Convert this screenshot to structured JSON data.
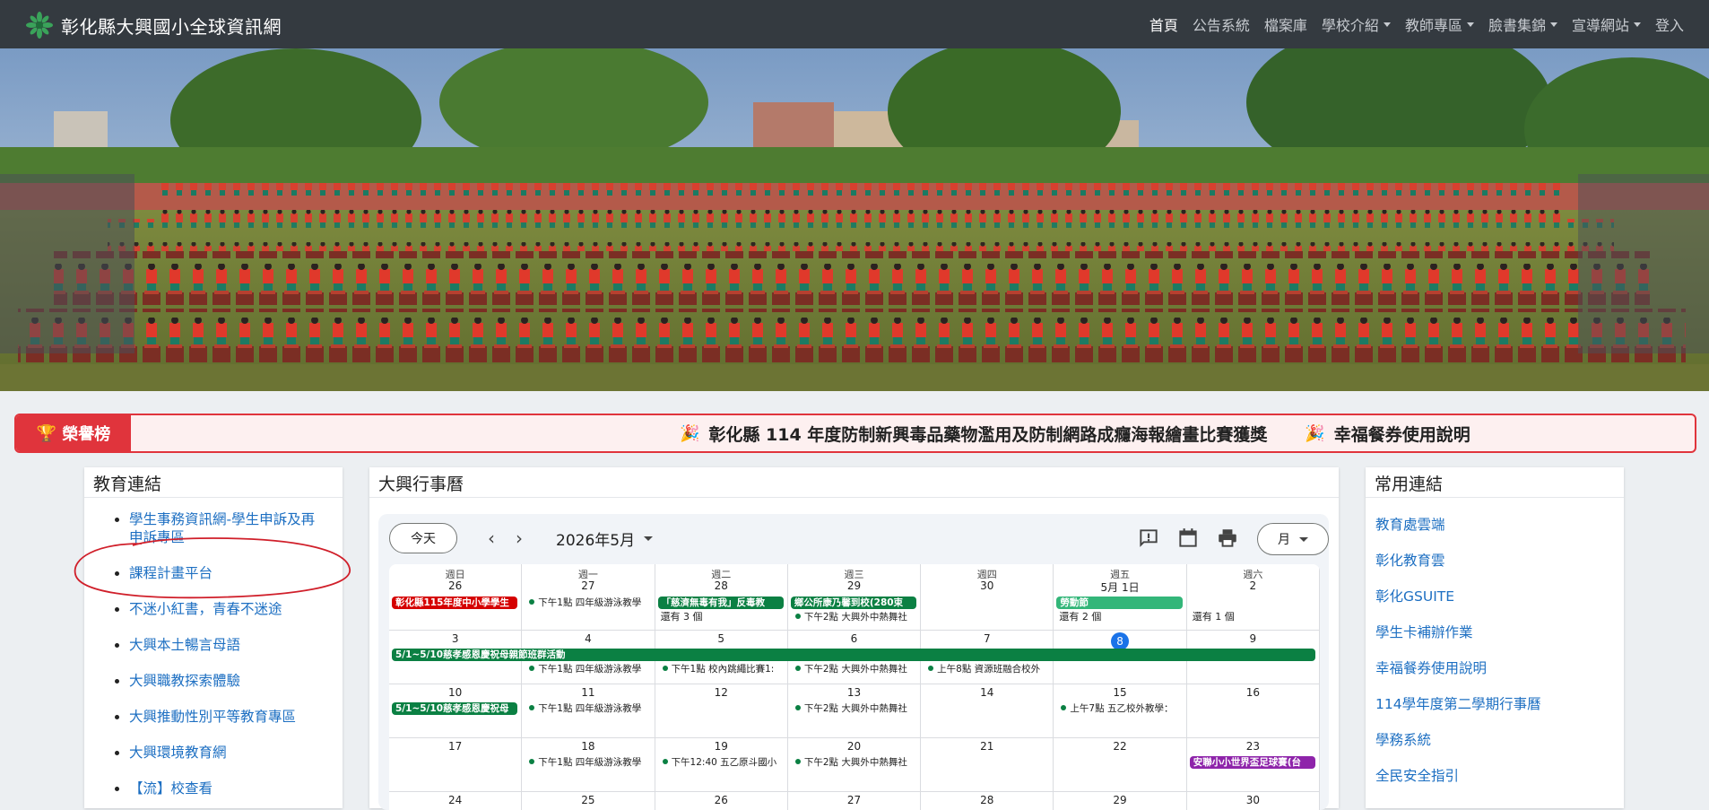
{
  "navbar": {
    "brand": "彰化縣大興國小全球資訊網",
    "items": [
      {
        "label": "首頁",
        "active": true,
        "dropdown": false
      },
      {
        "label": "公告系統",
        "dropdown": false
      },
      {
        "label": "檔案庫",
        "dropdown": false
      },
      {
        "label": "學校介紹",
        "dropdown": true
      },
      {
        "label": "教師專區",
        "dropdown": true
      },
      {
        "label": "臉書集錦",
        "dropdown": true
      },
      {
        "label": "宣導網站",
        "dropdown": true
      },
      {
        "label": "登入",
        "dropdown": false
      }
    ]
  },
  "honor": {
    "label": "榮譽榜",
    "icon": "trophy-icon",
    "items": [
      "彰化縣 114 年度防制新興毒品藥物濫用及防制網路成癮海報繪畫比賽獲獎",
      "幸福餐券使用說明"
    ]
  },
  "edu_links": {
    "title": "教育連結",
    "items": [
      "學生事務資訊網-學生申訴及再申訴專區",
      "課程計畫平台",
      "不迷小紅書，青春不迷途",
      "大興本土暢言母語",
      "大興職教探索體驗",
      "大興推動性別平等教育專區",
      "大興環境教育網",
      "【流】校查看"
    ]
  },
  "common_links": {
    "title": "常用連結",
    "items": [
      "教育處雲端",
      "彰化教育雲",
      "彰化GSUITE",
      "學生卡補辦作業",
      "幸福餐券使用說明",
      "114學年度第二學期行事曆",
      "學務系統",
      "全民安全指引"
    ]
  },
  "calendar": {
    "title": "大興行事曆",
    "today_label": "今天",
    "month_label": "2026年5月",
    "view_label": "月",
    "weekdays": [
      "週日",
      "週一",
      "週二",
      "週三",
      "週四",
      "週五",
      "週六"
    ],
    "weeks": [
      [
        "26",
        "27",
        "28",
        "29",
        "30",
        "5月 1日",
        "2"
      ],
      [
        "3",
        "4",
        "5",
        "6",
        "7",
        "8",
        "9"
      ],
      [
        "10",
        "11",
        "12",
        "13",
        "14",
        "15",
        "16"
      ],
      [
        "17",
        "18",
        "19",
        "20",
        "21",
        "22",
        "23"
      ],
      [
        "24",
        "25",
        "26",
        "27",
        "28",
        "29",
        "30"
      ]
    ],
    "today": "8",
    "colors": {
      "red": "#d50000",
      "teal": "#0b8043",
      "green": "#33b679",
      "purple": "#8e24aa",
      "today": "#1a73e8"
    },
    "events": [
      {
        "week": 0,
        "day": 0,
        "text": "彰化縣115年度中小學學生",
        "style": "bar",
        "color": "red"
      },
      {
        "week": 0,
        "day": 1,
        "text": "下午1點  四年級游泳教學",
        "style": "dot"
      },
      {
        "week": 0,
        "day": 2,
        "text": "「慈濟無毒有我」反毒教",
        "style": "bar",
        "color": "teal"
      },
      {
        "week": 0,
        "day": 3,
        "text": "鄉公所康乃馨到校(280束",
        "style": "bar",
        "color": "teal"
      },
      {
        "week": 0,
        "day": 3,
        "text": "下午2點  大興外中熱舞社",
        "style": "dot",
        "row": 1
      },
      {
        "week": 0,
        "day": 5,
        "text": "勞動節",
        "style": "bar",
        "color": "green"
      },
      {
        "week": 0,
        "day": 2,
        "text": "還有 3 個",
        "style": "more",
        "row": 1
      },
      {
        "week": 0,
        "day": 5,
        "text": "還有 2 個",
        "style": "more",
        "row": 1
      },
      {
        "week": 0,
        "day": 6,
        "text": "還有 1 個",
        "style": "more",
        "row": 1
      },
      {
        "week": 1,
        "day": 0,
        "span": 7,
        "text": "5/1~5/10慈孝感恩慶祝母親節班群活動",
        "style": "bar",
        "color": "teal"
      },
      {
        "week": 1,
        "day": 1,
        "text": "下午1點  四年級游泳教學",
        "style": "dot",
        "row": 1
      },
      {
        "week": 1,
        "day": 2,
        "text": "下午1點  校內跳繩比賽1:",
        "style": "dot",
        "row": 1
      },
      {
        "week": 1,
        "day": 3,
        "text": "下午2點  大興外中熱舞社",
        "style": "dot",
        "row": 1
      },
      {
        "week": 1,
        "day": 4,
        "text": "上午8點  資源班融合校外",
        "style": "dot",
        "row": 1
      },
      {
        "week": 2,
        "day": 0,
        "text": "5/1~5/10慈孝感恩慶祝母",
        "style": "bar",
        "color": "teal"
      },
      {
        "week": 2,
        "day": 1,
        "text": "下午1點  四年級游泳教學",
        "style": "dot"
      },
      {
        "week": 2,
        "day": 3,
        "text": "下午2點  大興外中熱舞社",
        "style": "dot"
      },
      {
        "week": 2,
        "day": 5,
        "text": "上午7點  五乙校外教學：",
        "style": "dot"
      },
      {
        "week": 3,
        "day": 1,
        "text": "下午1點  四年級游泳教學",
        "style": "dot"
      },
      {
        "week": 3,
        "day": 2,
        "text": "下午12:40  五乙原斗國小",
        "style": "dot"
      },
      {
        "week": 3,
        "day": 3,
        "text": "下午2點  大興外中熱舞社",
        "style": "dot"
      },
      {
        "week": 3,
        "day": 6,
        "text": "安聯小小世界盃足球賽(台",
        "style": "bar",
        "color": "purple"
      }
    ]
  }
}
